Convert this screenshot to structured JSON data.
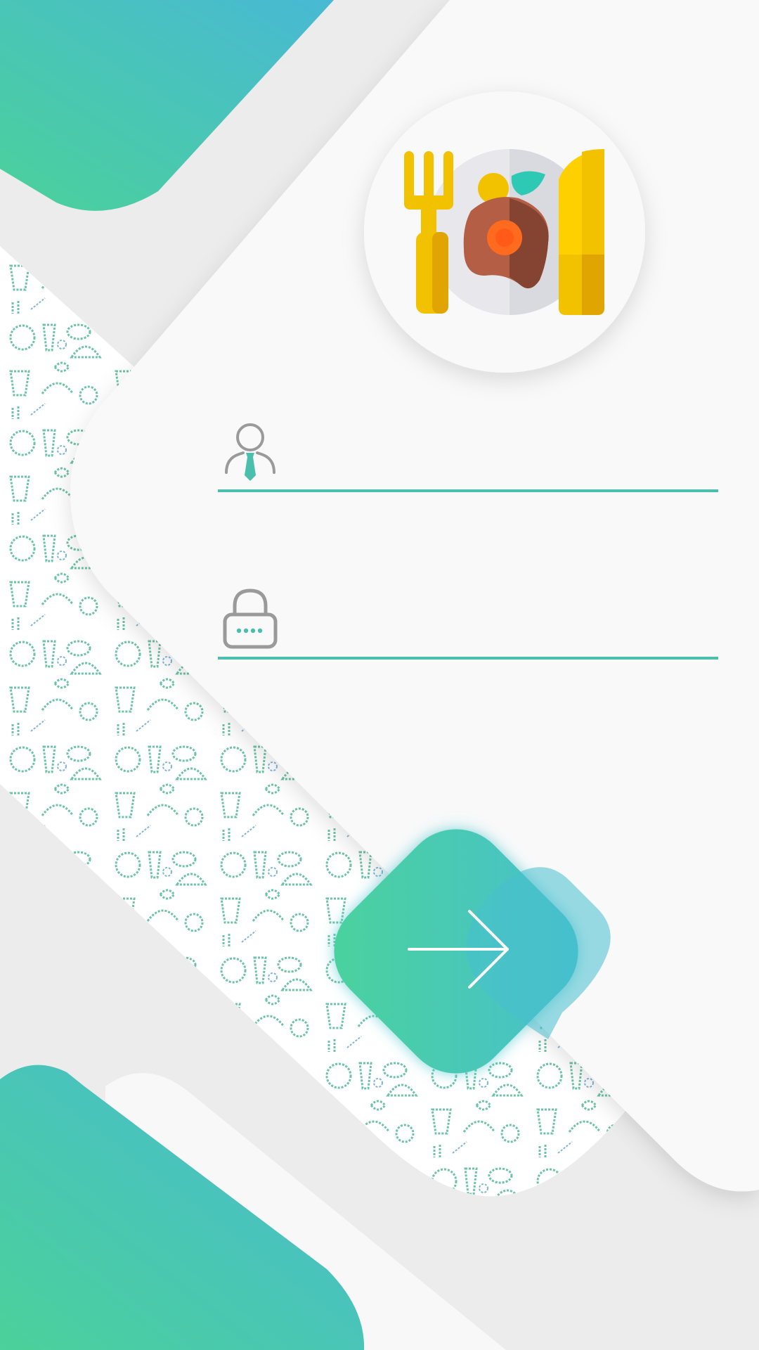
{
  "colors": {
    "background": "#ececec",
    "card": "#f9f9f9",
    "gradient_start": "#4bd19a",
    "gradient_end": "#48b9d4",
    "accent_underline": "#4bbfae",
    "icon_gray": "#9a9a9a"
  },
  "logo": {
    "icon": "plate-with-fork-and-knife-icon"
  },
  "login_form": {
    "username": {
      "icon": "user-with-tie-icon",
      "value": "",
      "placeholder": ""
    },
    "password": {
      "icon": "lock-icon",
      "value": "",
      "placeholder": ""
    },
    "submit": {
      "icon": "arrow-right-icon"
    }
  },
  "background_pattern": {
    "icon": "food-doodle-pattern"
  }
}
